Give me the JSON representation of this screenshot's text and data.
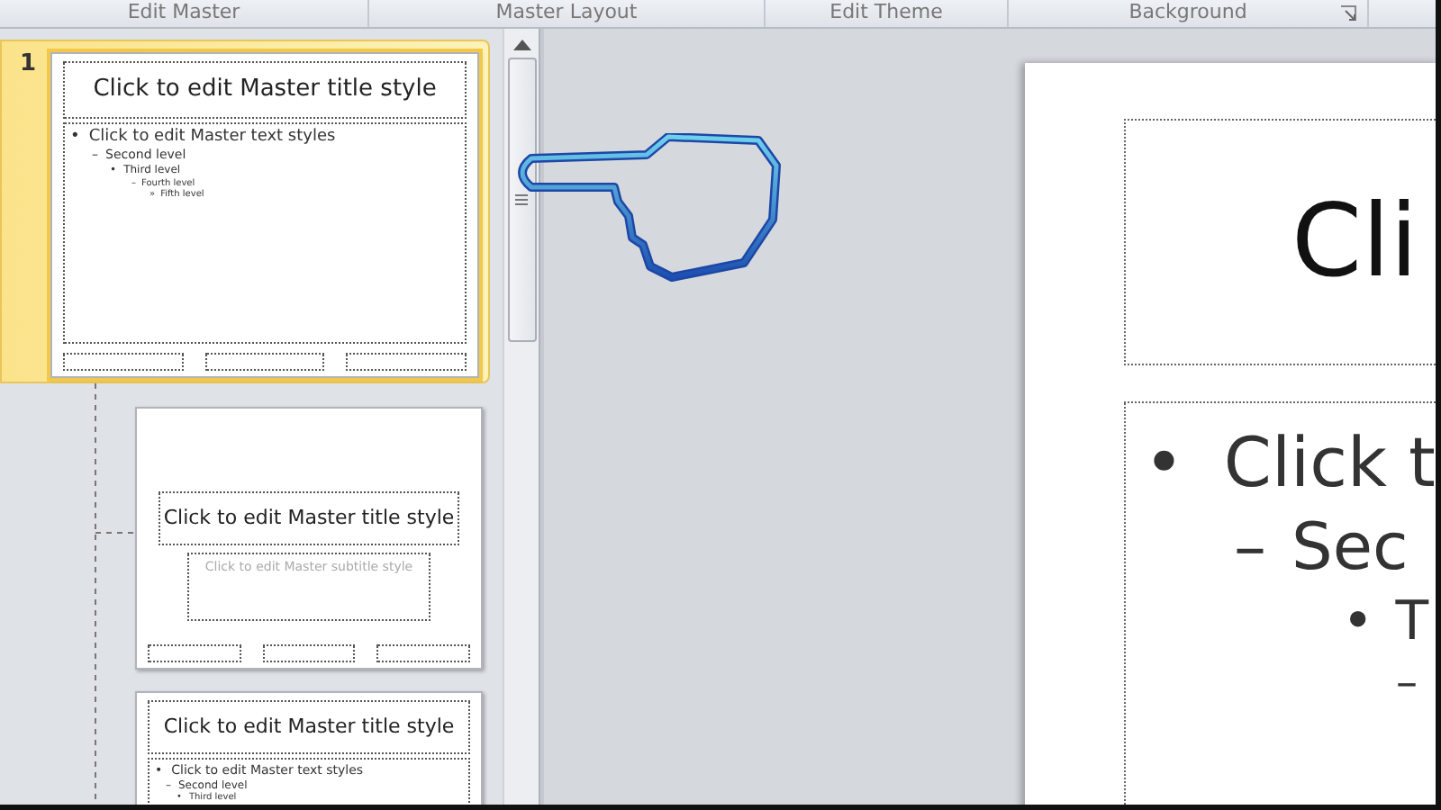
{
  "ribbon_groups": [
    {
      "label": "Edit Master"
    },
    {
      "label": "Master Layout"
    },
    {
      "label": "Edit Theme"
    },
    {
      "label": "Background",
      "launcher": true
    }
  ],
  "thumbnails": [
    {
      "kind": "master",
      "number": "1",
      "selected": true,
      "title": "Click to edit Master title style",
      "levels": [
        {
          "marker": "•",
          "text": "Click to edit Master text styles",
          "children": [
            {
              "marker": "–",
              "text": "Second  level",
              "children": [
                {
                  "marker": "•",
                  "text": "Third level",
                  "children": [
                    {
                      "marker": "–",
                      "text": "Fourth level",
                      "children": [
                        {
                          "marker": "»",
                          "text": "Fifth level"
                        }
                      ]
                    }
                  ]
                }
              ]
            }
          ]
        }
      ]
    },
    {
      "kind": "title",
      "selected": false,
      "title": "Click to edit Master title style",
      "subtitle": "Click to edit Master subtitle style"
    },
    {
      "kind": "content",
      "selected": false,
      "title": "Click to edit Master title style",
      "levels": [
        {
          "marker": "•",
          "text": "Click to edit Master text styles",
          "children": [
            {
              "marker": "–",
              "text": "Second level",
              "children": [
                {
                  "marker": "•",
                  "text": "Third level"
                }
              ]
            }
          ]
        }
      ]
    }
  ],
  "slide": {
    "title": "Cli",
    "levels": [
      {
        "marker": "•",
        "text": "Click t",
        "children": [
          {
            "marker": "–",
            "text": "Sec",
            "children": [
              {
                "marker": "•",
                "text": "T",
                "children": [
                  {
                    "marker": "–"
                  }
                ]
              }
            ]
          }
        ]
      }
    ]
  }
}
